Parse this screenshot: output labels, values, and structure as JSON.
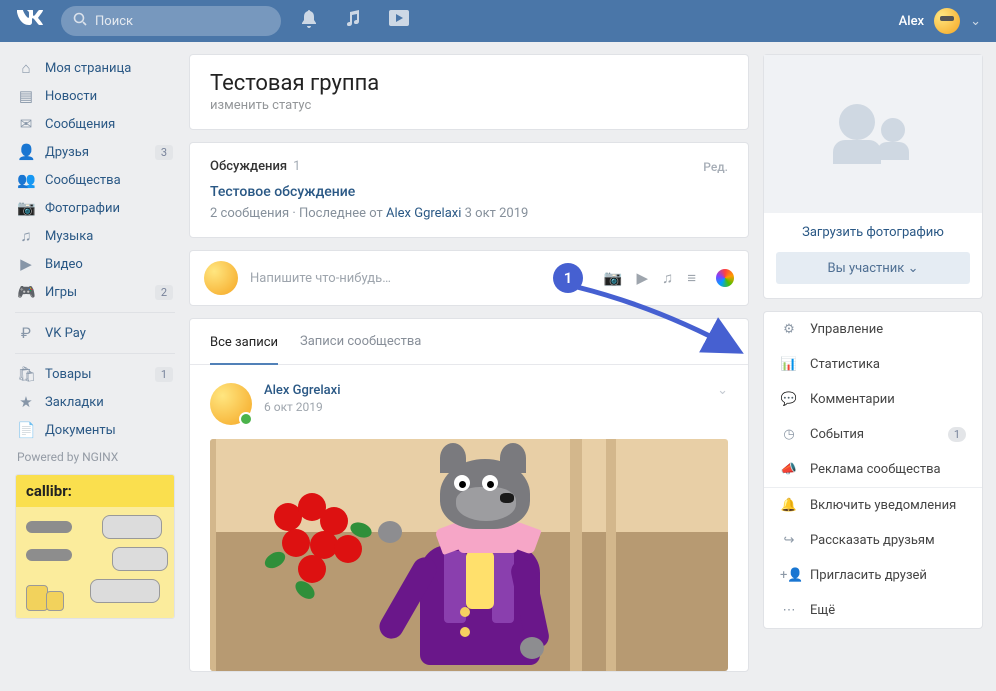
{
  "top": {
    "search_placeholder": "Поиск",
    "user": "Alex"
  },
  "nav": {
    "items": [
      {
        "label": "Моя страница"
      },
      {
        "label": "Новости"
      },
      {
        "label": "Сообщения"
      },
      {
        "label": "Друзья",
        "count": "3"
      },
      {
        "label": "Сообщества"
      },
      {
        "label": "Фотографии"
      },
      {
        "label": "Музыка"
      },
      {
        "label": "Видео"
      },
      {
        "label": "Игры",
        "count": "2"
      },
      {
        "label": "VK Pay"
      },
      {
        "label": "Товары",
        "count": "1"
      },
      {
        "label": "Закладки"
      },
      {
        "label": "Документы"
      }
    ],
    "powered": "Powered by NGINX",
    "ad_title": "callibr:"
  },
  "group": {
    "title": "Тестовая группа",
    "status": "изменить статус"
  },
  "discussions": {
    "heading": "Обсуждения",
    "count": "1",
    "edit": "Ред.",
    "topic_title": "Тестовое обсуждение",
    "meta_prefix": "2 сообщения",
    "meta_mid": "Последнее от",
    "meta_user": "Alex Ggrelaxi",
    "meta_date": "3 окт 2019"
  },
  "newpost": {
    "placeholder": "Напишите что-нибудь…"
  },
  "tabs": {
    "all": "Все записи",
    "community": "Записи сообщества"
  },
  "wall": {
    "author": "Alex Ggrelaxi",
    "date": "6 окт 2019"
  },
  "rcol": {
    "upload": "Загрузить фотографию",
    "member": "Вы участник",
    "menu": [
      {
        "label": "Управление"
      },
      {
        "label": "Статистика"
      },
      {
        "label": "Комментарии"
      },
      {
        "label": "События",
        "badge": "1"
      },
      {
        "label": "Реклама сообщества"
      }
    ],
    "menu2": [
      {
        "label": "Включить уведомления"
      },
      {
        "label": "Рассказать друзьям"
      },
      {
        "label": "Пригласить друзей"
      },
      {
        "label": "Ещё"
      }
    ]
  },
  "annot": {
    "num": "1"
  }
}
